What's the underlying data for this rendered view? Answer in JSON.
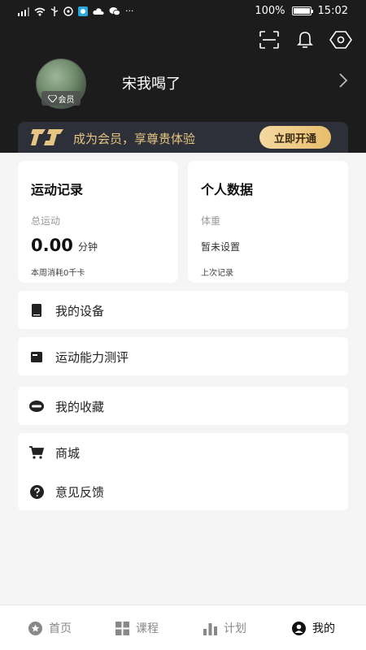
{
  "status_bar": {
    "left_icons": [
      "signal-icon",
      "wifi-icon",
      "usb-icon",
      "vpn-icon",
      "app-icon",
      "cloud-icon",
      "wechat-icon"
    ],
    "more": "···",
    "battery": "100%",
    "time": "15:02"
  },
  "header": {
    "top_actions": [
      "scan-icon",
      "bell-icon",
      "settings-icon"
    ],
    "username": "宋我喝了",
    "member_badge": "会员"
  },
  "vip_banner": {
    "text": "成为会员，享尊贵体验",
    "button": "立即开通",
    "colors": {
      "text": "#e6c481",
      "button": "#ecc77f"
    }
  },
  "cards": {
    "exercise": {
      "title": "运动记录",
      "label": "总运动",
      "value": "0.00",
      "unit": "分钟",
      "footer": "本周消耗0千卡"
    },
    "personal": {
      "title": "个人数据",
      "label": "体重",
      "value": "暂未设置",
      "footer": "上次记录"
    }
  },
  "menu": {
    "my_devices": "我的设备",
    "ability_test": "运动能力测评",
    "favorites": "我的收藏",
    "shop": "商城",
    "feedback": "意见反馈"
  },
  "bottom_nav": {
    "items": [
      {
        "label": "首页",
        "icon": "star-icon",
        "active": false
      },
      {
        "label": "课程",
        "icon": "grid-icon",
        "active": false
      },
      {
        "label": "计划",
        "icon": "bar-chart-icon",
        "active": false
      },
      {
        "label": "我的",
        "icon": "user-icon",
        "active": true
      }
    ]
  }
}
